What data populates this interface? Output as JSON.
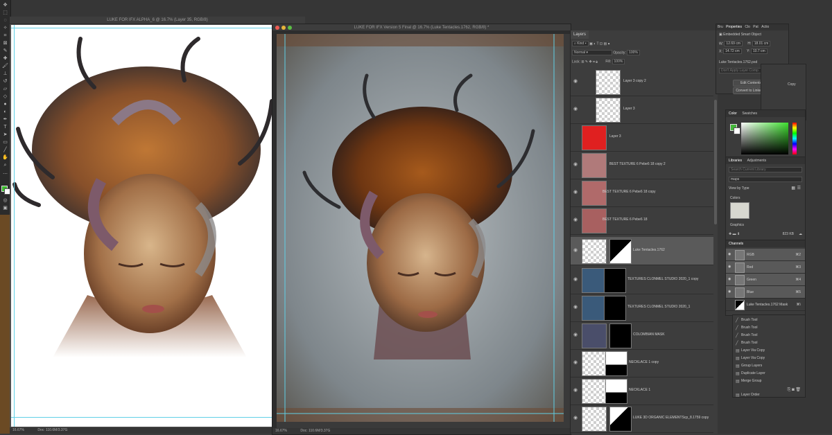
{
  "window1": {
    "title": "LUKE FOR IFX ALPHA_6 @ 16.7% (Layer 35, RGB/8)",
    "zoom": "16.67%",
    "doc_info": "Doc: 110.6M/3.37G"
  },
  "window2": {
    "title": "LUKE FOR IFX Version 5 Final @ 16.7% (Luke Tentacles.1762, RGB/8) *",
    "zoom": "16.67%",
    "doc_info": "Doc: 110.6M/3.37G"
  },
  "layers_panel": {
    "tab": "Layers",
    "kind": "Kind",
    "blend_mode": "Normal",
    "opacity_label": "Opacity:",
    "opacity_value": "100%",
    "lock_label": "Lock:",
    "fill_label": "Fill:",
    "fill_value": "100%",
    "layers": [
      {
        "name": "Layer 3 copy 2",
        "selected": false
      },
      {
        "name": "Layer 3",
        "selected": false
      },
      {
        "name": "Layer 3",
        "selected": false
      },
      {
        "name": "BEST TEXTURE 6 Pebe6 18 copy 2",
        "selected": false
      },
      {
        "name": "BEST TEXTURE 6 Pebe6 18 copy",
        "selected": false
      },
      {
        "name": "BEST TEXTURE 6 Pebe6 18",
        "selected": false
      },
      {
        "name": "Luke Tentacles.1762",
        "selected": true
      },
      {
        "name": "TEXTURES CLONMEL STUDIO 2020_1 copy",
        "selected": false
      },
      {
        "name": "TEXTURES CLONMEL STUDIO 2020_1",
        "selected": false
      },
      {
        "name": "COLOMBIAN MASK",
        "selected": false
      },
      {
        "name": "NECKLACE 1 copy",
        "selected": false
      },
      {
        "name": "NECKLACE 1",
        "selected": false
      },
      {
        "name": "LUKE 3D ORGANIC ELEMENTScp_8.1759 copy",
        "selected": false
      }
    ]
  },
  "properties_panel": {
    "tabs": [
      "Bru",
      "Properties",
      "Clo",
      "Pat",
      "Actio"
    ],
    "object_type": "Embedded Smart Object",
    "w_label": "W:",
    "w_value": "12.69 cm",
    "h_label": "H:",
    "h_value": "18.01 cm",
    "x_label": "X:",
    "x_value": "14.72 cm",
    "y_label": "Y:",
    "y_value": "10.7 cm",
    "file": "Luke Tentacles.1762.psd",
    "comp_placeholder": "Don't Apply Layer Comp",
    "edit_button": "Edit Contents",
    "convert_button": "Convert to Linked...",
    "copy_label": "Copy"
  },
  "color_panel": {
    "tabs": [
      "Color",
      "Swatches"
    ],
    "foreground": "#43b83a",
    "background": "#ffffff"
  },
  "libraries_panel": {
    "tabs": [
      "Libraries",
      "Adjustments"
    ],
    "search_placeholder": "Search Current Library",
    "library": "maps",
    "view_by": "View by Type",
    "colors_label": "Colors",
    "graphics_label": "Graphics",
    "size": "823 KB"
  },
  "channels_panel": {
    "tab": "Channels",
    "channels": [
      {
        "name": "RGB",
        "shortcut": "⌘2",
        "selected": true
      },
      {
        "name": "Red",
        "shortcut": "⌘3",
        "selected": true
      },
      {
        "name": "Green",
        "shortcut": "⌘4",
        "selected": true
      },
      {
        "name": "Blue",
        "shortcut": "⌘5",
        "selected": true
      },
      {
        "name": "Luke Tentacles.1762 Mask",
        "shortcut": "⌘\\",
        "selected": false
      }
    ]
  },
  "history_panel": {
    "items": [
      "Brush Tool",
      "Brush Tool",
      "Brush Tool",
      "Brush Tool",
      "Layer Via Copy",
      "Layer Via Copy",
      "Group Layers",
      "Duplicate Layer",
      "Merge Group",
      "Layer Order"
    ]
  }
}
